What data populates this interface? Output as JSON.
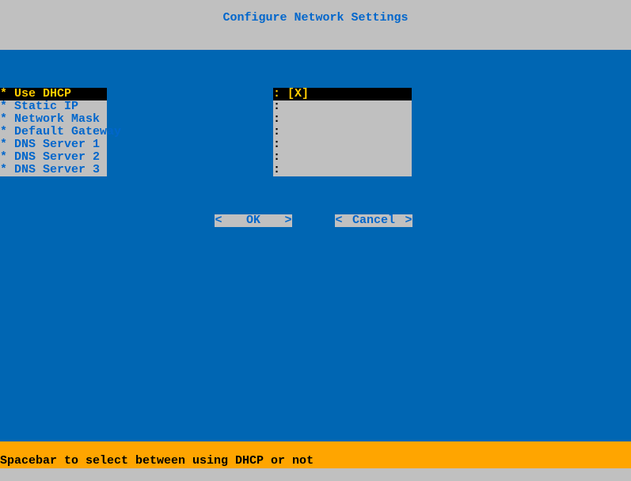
{
  "header": {
    "title": "Configure Network Settings"
  },
  "options": [
    {
      "marker": "* ",
      "label": "Use DHCP",
      "selected": true
    },
    {
      "marker": "* ",
      "label": "Static IP",
      "selected": false
    },
    {
      "marker": "* ",
      "label": "Network Mask",
      "selected": false
    },
    {
      "marker": "* ",
      "label": "Default Gateway",
      "selected": false
    },
    {
      "marker": "* ",
      "label": "DNS Server 1",
      "selected": false
    },
    {
      "marker": "* ",
      "label": "DNS Server 2",
      "selected": false
    },
    {
      "marker": "* ",
      "label": "DNS Server 3",
      "selected": false
    }
  ],
  "values": [
    {
      "text": ": [X]",
      "selected": true
    },
    {
      "text": ":",
      "selected": false
    },
    {
      "text": ":",
      "selected": false
    },
    {
      "text": ":",
      "selected": false
    },
    {
      "text": ":",
      "selected": false
    },
    {
      "text": ":",
      "selected": false
    },
    {
      "text": ":",
      "selected": false
    }
  ],
  "buttons": {
    "ok": "OK",
    "cancel": "Cancel",
    "chev_left": "<",
    "chev_right": ">"
  },
  "footer": {
    "hint": "Spacebar to select between using DHCP or not"
  }
}
